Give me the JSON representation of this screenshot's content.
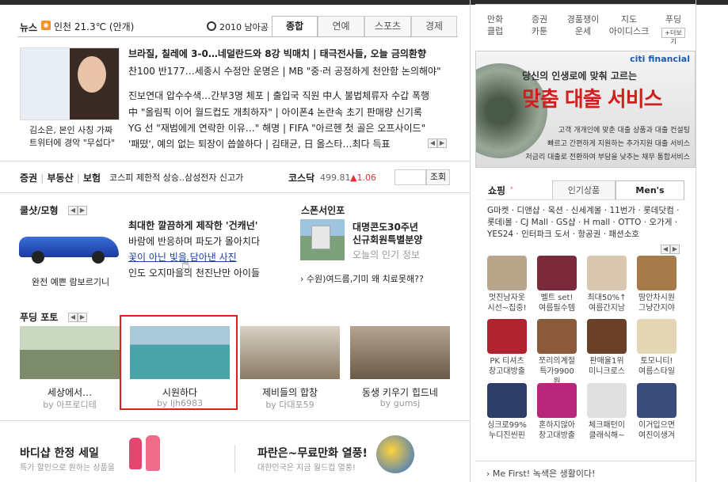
{
  "news": {
    "title": "뉴스",
    "rss": "RSS",
    "weather": "인천 21.3℃ (안개)",
    "worldcup": "2010 남아공",
    "tabs": [
      "종합",
      "연예",
      "스포츠",
      "경제"
    ],
    "headline": "브라질, 칠레에 3-0…네덜란드와 8강 빅매치 | 태극전사들, 오늘 금의환향",
    "lines": [
      "찬100 반177…세종시 수정안 운명은 | MB \"중·러 공정하게 천안함 논의해야\"",
      "진보연대 압수수색…간부3명 체포 | 출입국 직원 中人 불법체류자 수갑 폭행",
      "中 \"올림픽 이어 월드컵도 개최하자\" | 아이폰4 논란속 초기 판매량 신기록",
      "YG 선 \"재범에게 연락한 이유…\" 해명 | FIFA \"아르헨 첫 골은 오프사이드\"",
      "'패떴', 예의 없는 퇴장이 씁쓸하다 | 김태균, 日 올스타…최다 득표"
    ],
    "photo_caption_1": "김소은, 본인 사칭 가짜",
    "photo_caption_2": "트위터에 경악 \"무섭다\""
  },
  "finance": {
    "links": [
      "증권",
      "부동산",
      "보험"
    ],
    "ticker": "코스피 제한적 상승..삼성전자 신고가",
    "index_name": "코스닥",
    "index_value": "499.81",
    "index_change": "▲1.06",
    "search_button": "조회"
  },
  "coolshot": {
    "title": "쿨샷/모형",
    "caption": "완전 예쁜 람보르기니",
    "headline": "최대한 깔끔하게 제작한 '건캐넌'",
    "items": [
      "바람에 반응하며 파도가 몰아치다",
      "꽃이 아닌 빛을 담아낸 사진",
      "인도 오지마을의 천진난만 아이들"
    ]
  },
  "sponsor": {
    "title": "스폰서인포",
    "headline_1": "대명콘도30주년",
    "headline_2": "신규회원특별분양",
    "sub": "오늘의 인기 정보",
    "link": "수원)여드름,기미 왜 치료못해??"
  },
  "pudding": {
    "title": "푸딩 포토",
    "photos": [
      {
        "title": "세상에서…",
        "author": "by 아프로디테"
      },
      {
        "title": "시원하다",
        "author": "by ljh6983"
      },
      {
        "title": "제비들의 합창",
        "author": "by 다대포59"
      },
      {
        "title": "동생 키우기 힙드네",
        "author": "by gumsj"
      }
    ]
  },
  "promos": {
    "left_title": "바디샵 한정 세일",
    "left_sub": "특가 할인으로 원하는 상품을",
    "right_title": "파란은~무료만화 열풍!",
    "right_sub": "대한민국은 지금 월드컵 열풍!"
  },
  "right": {
    "quicklinks": [
      "만화\n클럽",
      "증권\n카툰",
      "경품쟁이\n운세",
      "지도\n아이디스크",
      "푸딩"
    ],
    "more": "+더보기",
    "ad_brand": "citi financial",
    "ad_line1": "당신의 인생로에 맞춰 고르는",
    "ad_big": "맞춤 대출 서비스",
    "ad_l1": "고객 개개인에 맞춘 대출 상품과 대출 컨설팅",
    "ad_l2": "빠르고 간편하게 지원하는 추가지원 대출 서비스",
    "ad_l3": "저금리 대출로 전환하여 부담을 낮추는 채무 통합서비스",
    "shopping_title": "쇼핑",
    "shop_tabs": [
      "인기상품",
      "Men's"
    ],
    "malls": "G마켓 · 디앤샵 · 옥션 · 신세계몰 · 11번가 · 롯데닷컴 · 롯데i몰 · CJ Mall · GS샵 · H mall · OTTO · 오가게 · YES24 · 인터파크 도서 · 항공권 · 패션소호",
    "products": [
      {
        "l1": "멋진남자옷",
        "l2": "시선~집중!",
        "c": "#b8a58a"
      },
      {
        "l1": "벨트 set!",
        "l2": "여름필수템",
        "c": "#7a2a3a"
      },
      {
        "l1": "최대50%↑",
        "l2": "여름간지남",
        "c": "#d9c7b0"
      },
      {
        "l1": "땀안차시원",
        "l2": "그냥간지야",
        "c": "#a67a4a"
      },
      {
        "l1": "PK 티셔츠",
        "l2": "창고대방출",
        "c": "#b0242f"
      },
      {
        "l1": "쪼리의계절",
        "l2": "특가9900원",
        "c": "#8a5a3a"
      },
      {
        "l1": "판매율1위",
        "l2": "미니크로스",
        "c": "#6a4028"
      },
      {
        "l1": "토모니티!",
        "l2": "여름스타일",
        "c": "#e4d6b4"
      },
      {
        "l1": "싱크로99%",
        "l2": "누디진씬핀",
        "c": "#2d3f66"
      },
      {
        "l1": "혼하지않아",
        "l2": "창고대방출",
        "c": "#b8287a"
      },
      {
        "l1": "체크패턴이",
        "l2": "클래식해~",
        "c": "#e0e0e0"
      },
      {
        "l1": "이거입으면",
        "l2": "여친이생겨",
        "c": "#3a4d7a"
      }
    ],
    "footer": "Me First! 녹색은 생활이다!"
  },
  "colors": {
    "accent_red": "#e03030",
    "link_blue": "#1a3e9a",
    "highlight_box": "#e02020"
  }
}
